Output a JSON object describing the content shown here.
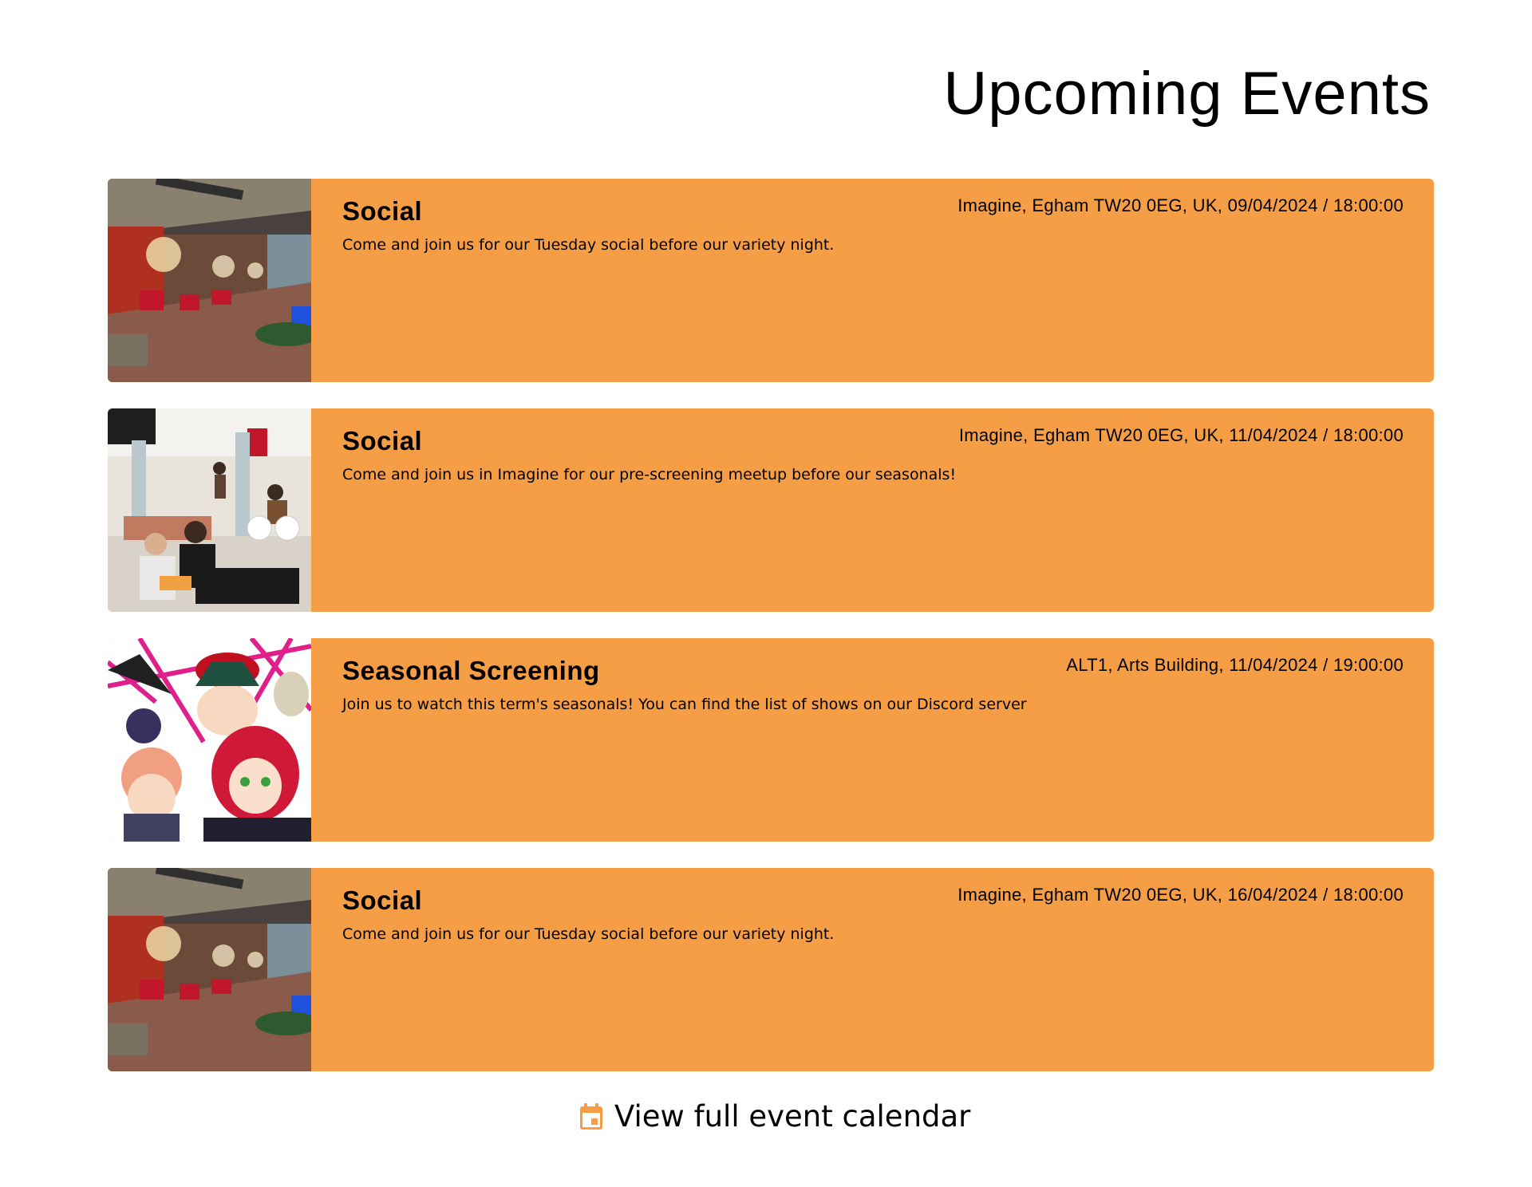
{
  "page": {
    "title": "Upcoming Events"
  },
  "colors": {
    "card_background": "#f59e45",
    "accent": "#f59e45"
  },
  "events": [
    {
      "title": "Social",
      "location_datetime": "Imagine, Egham TW20 0EG, UK, 09/04/2024 / 18:00:00",
      "description": "Come and join us for our Tuesday social before our variety night.",
      "image": "venue-interior-photo"
    },
    {
      "title": "Social",
      "location_datetime": "Imagine, Egham TW20 0EG, UK, 11/04/2024 / 18:00:00",
      "description": "Come and join us in Imagine for our pre-screening meetup before our seasonals!",
      "image": "students-gathering-photo"
    },
    {
      "title": "Seasonal Screening",
      "location_datetime": "ALT1, Arts Building, 11/04/2024 / 19:00:00",
      "description": "Join us to watch this term's seasonals! You can find the list of shows on our Discord server",
      "image": "anime-artwork"
    },
    {
      "title": "Social",
      "location_datetime": "Imagine, Egham TW20 0EG, UK, 16/04/2024 / 18:00:00",
      "description": "Come and join us for our Tuesday social before our variety night.",
      "image": "venue-interior-photo"
    }
  ],
  "calendar_link": {
    "label": "View full event calendar",
    "icon": "calendar-icon"
  }
}
